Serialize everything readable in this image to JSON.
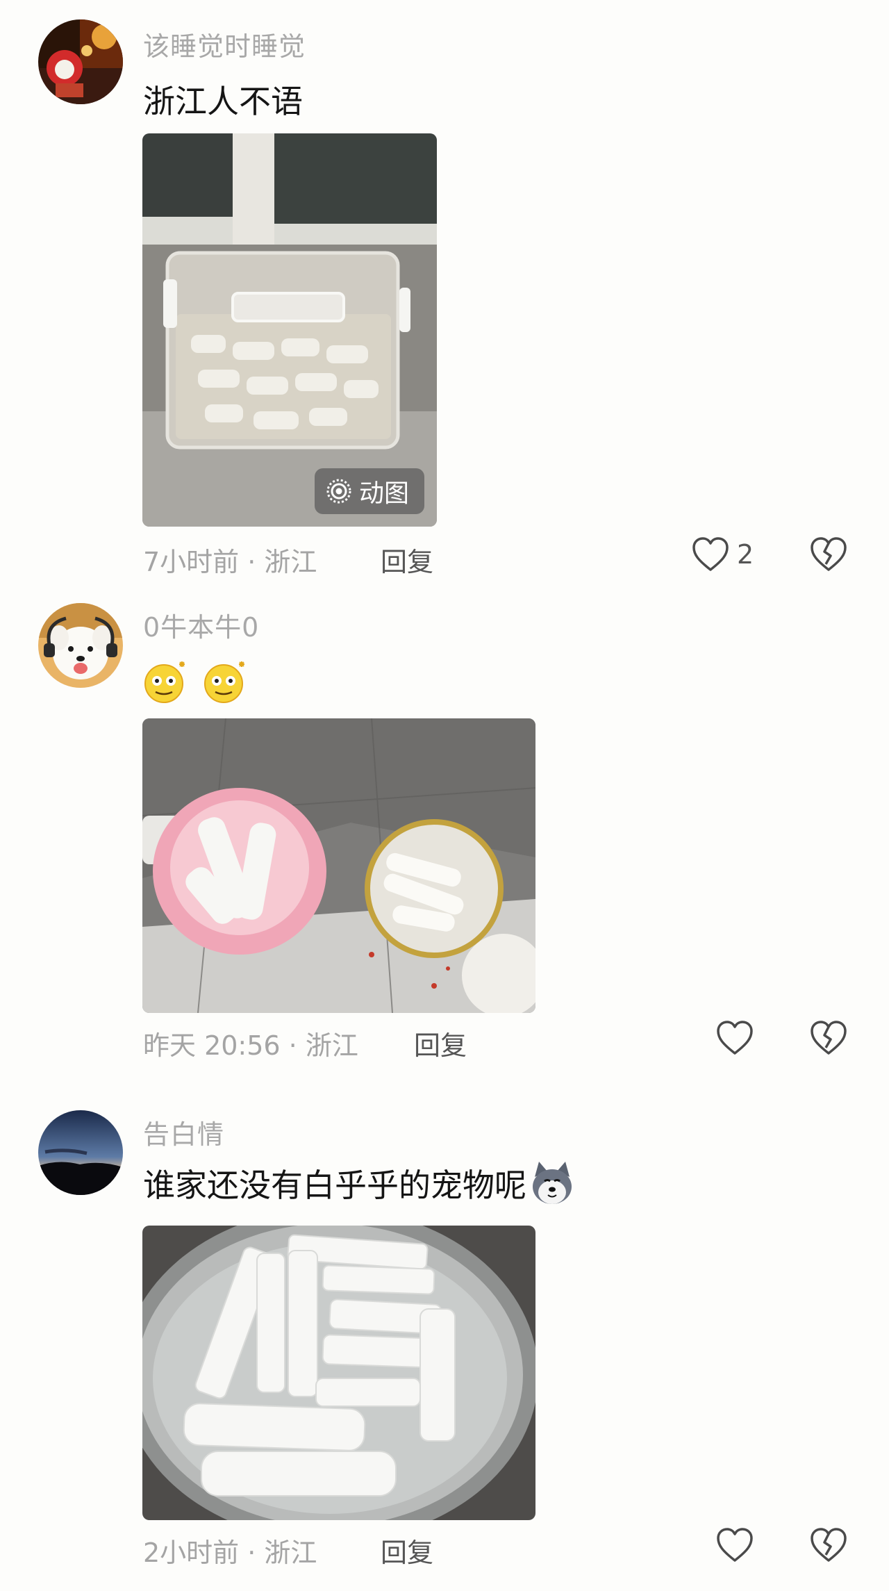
{
  "comments": [
    {
      "username": "该睡觉时睡觉",
      "text": "浙江人不语",
      "gif_badge": "动图",
      "meta": "7小时前 · 浙江",
      "reply_label": "回复",
      "like_count": "2"
    },
    {
      "username": "0牛本牛0",
      "text": "",
      "meta": "昨天 20:56 · 浙江",
      "reply_label": "回复",
      "like_count": ""
    },
    {
      "username": "告白情",
      "text": "谁家还没有白乎乎的宠物呢",
      "meta": "2小时前 · 浙江",
      "reply_label": "回复",
      "like_count": ""
    }
  ],
  "icons": {
    "like": "heart-outline-icon",
    "dislike": "broken-heart-icon",
    "gif": "live-photo-icon",
    "emoji": "dizzy-smiley-emoji",
    "pet_emoji": "husky-face-emoji"
  },
  "colors": {
    "background": "#fdfdfb",
    "username": "#a8a8a8",
    "text": "#151515",
    "meta": "#a4a4a4",
    "action": "#555555"
  }
}
